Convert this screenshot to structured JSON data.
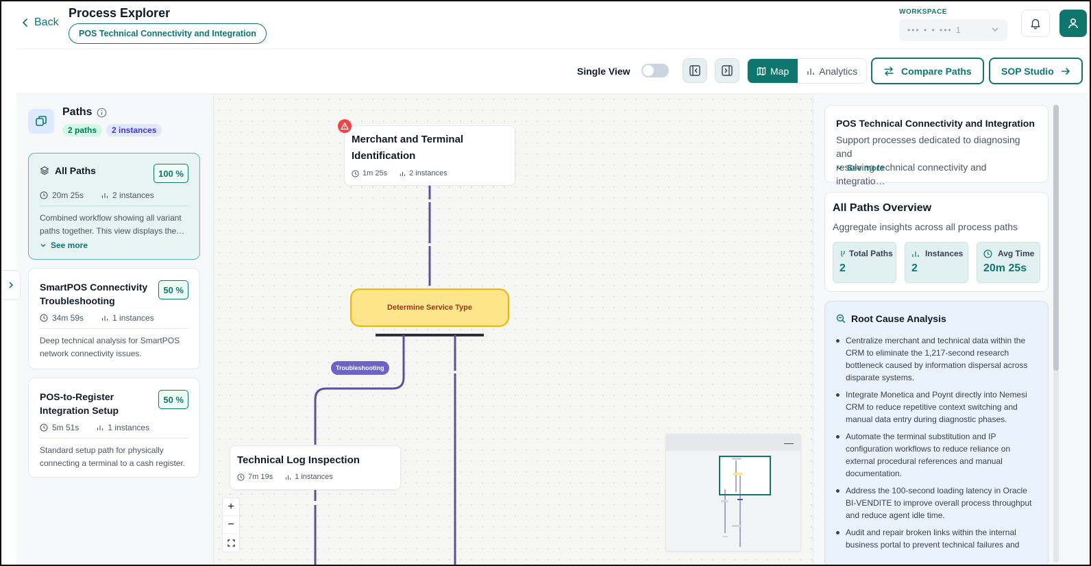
{
  "header": {
    "back_label": "Back",
    "title": "Process Explorer",
    "process_pill": "POS Technical Connectivity and Integration",
    "workspace_label": "WORKSPACE",
    "workspace_value": "••• • • ••• 1"
  },
  "toolbar": {
    "single_view_label": "Single View",
    "single_view_on": false,
    "map_label": "Map",
    "analytics_label": "Analytics",
    "compare_label": "Compare Paths",
    "sop_label": "SOP Studio",
    "active_view": "Map"
  },
  "left": {
    "title": "Paths",
    "paths_badge": "2 paths",
    "instances_badge": "2 instances",
    "cards": [
      {
        "name": "All Paths",
        "pct": "100 %",
        "time": "20m 25s",
        "instances": "2 instances",
        "desc_line1": "Combined workflow showing all variant",
        "desc_line2": "paths together. This view displays the…",
        "see_more": "See more"
      },
      {
        "name_line1": "SmartPOS Connectivity",
        "name_line2": "Troubleshooting",
        "pct": "50 %",
        "time": "34m 59s",
        "instances": "1 instances",
        "desc_line1": "Deep technical analysis for SmartPOS",
        "desc_line2": "network connectivity issues."
      },
      {
        "name_line1": "POS-to-Register",
        "name_line2": "Integration Setup",
        "pct": "50 %",
        "time": "5m 51s",
        "instances": "1 instances",
        "desc_line1": "Standard setup path for physically",
        "desc_line2": "connecting a terminal to a cash register."
      }
    ]
  },
  "canvas": {
    "node1": {
      "title_line1": "Merchant and Terminal",
      "title_line2": "Identification",
      "time": "1m 25s",
      "instances": "2 instances"
    },
    "decision": "Determine Service Type",
    "edge_label": "Troubleshooting",
    "node2": {
      "title": "Technical Log Inspection",
      "time": "7m 19s",
      "instances": "1 instances"
    },
    "edge_color": "#5b4fa0",
    "alert_color": "#ef4444"
  },
  "right": {
    "process_title": "POS Technical Connectivity and Integration",
    "process_desc_line1": "Support processes dedicated to diagnosing and",
    "process_desc_line2": "resolving technical connectivity and integratio…",
    "see_more": "See more",
    "overview_title": "All Paths Overview",
    "overview_sub": "Aggregate insights across all process paths",
    "stats": [
      {
        "label": "Total Paths",
        "value": "2"
      },
      {
        "label": "Instances",
        "value": "2"
      },
      {
        "label": "Avg Time",
        "value": "20m 25s"
      }
    ],
    "rca_title": "Root Cause Analysis",
    "rca_items": [
      "Centralize merchant and technical data within the CRM to eliminate the 1,217-second research bottleneck caused by information dispersal across disparate systems.",
      "Integrate Monetica and Poynt directly into Nemesi CRM to reduce repetitive context switching and manual data entry during diagnostic phases.",
      "Automate the terminal substitution and IP configuration workflows to reduce reliance on external procedural references and manual documentation.",
      "Address the 100-second loading latency in Oracle BI-VENDITE to improve overall process throughput and reduce agent idle time.",
      "Audit and repair broken links within the internal business portal to prevent technical failures and"
    ]
  },
  "colors": {
    "accent": "#0f766e",
    "decision_fill": "#fde68a",
    "decision_border": "#f4b400"
  }
}
